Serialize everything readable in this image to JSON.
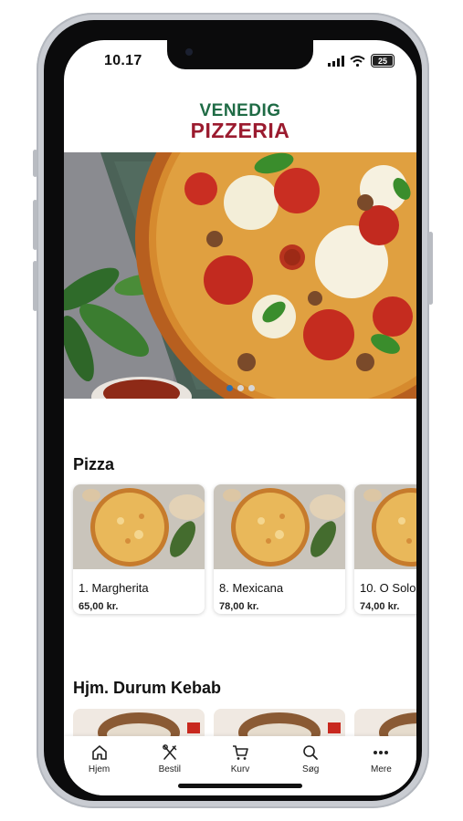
{
  "status": {
    "time": "10.17",
    "battery": "25"
  },
  "brand": {
    "line1": "VENEDIG",
    "line2": "PIZZERIA",
    "green": "#1f6b45",
    "red": "#9b1b2f"
  },
  "carousel": {
    "active_index": 0,
    "count": 3
  },
  "sections": [
    {
      "title": "Pizza",
      "items": [
        {
          "name": "1. Margherita",
          "price": "65,00 kr."
        },
        {
          "name": "8. Mexicana",
          "price": "78,00 kr."
        },
        {
          "name": "10. O Solo",
          "price": "74,00 kr."
        }
      ]
    },
    {
      "title": "Hjm. Durum Kebab"
    }
  ],
  "tabbar": [
    {
      "label": "Hjem",
      "icon": "home-icon"
    },
    {
      "label": "Bestil",
      "icon": "utensils-icon"
    },
    {
      "label": "Kurv",
      "icon": "cart-icon"
    },
    {
      "label": "Søg",
      "icon": "search-icon"
    },
    {
      "label": "Mere",
      "icon": "more-icon"
    }
  ]
}
